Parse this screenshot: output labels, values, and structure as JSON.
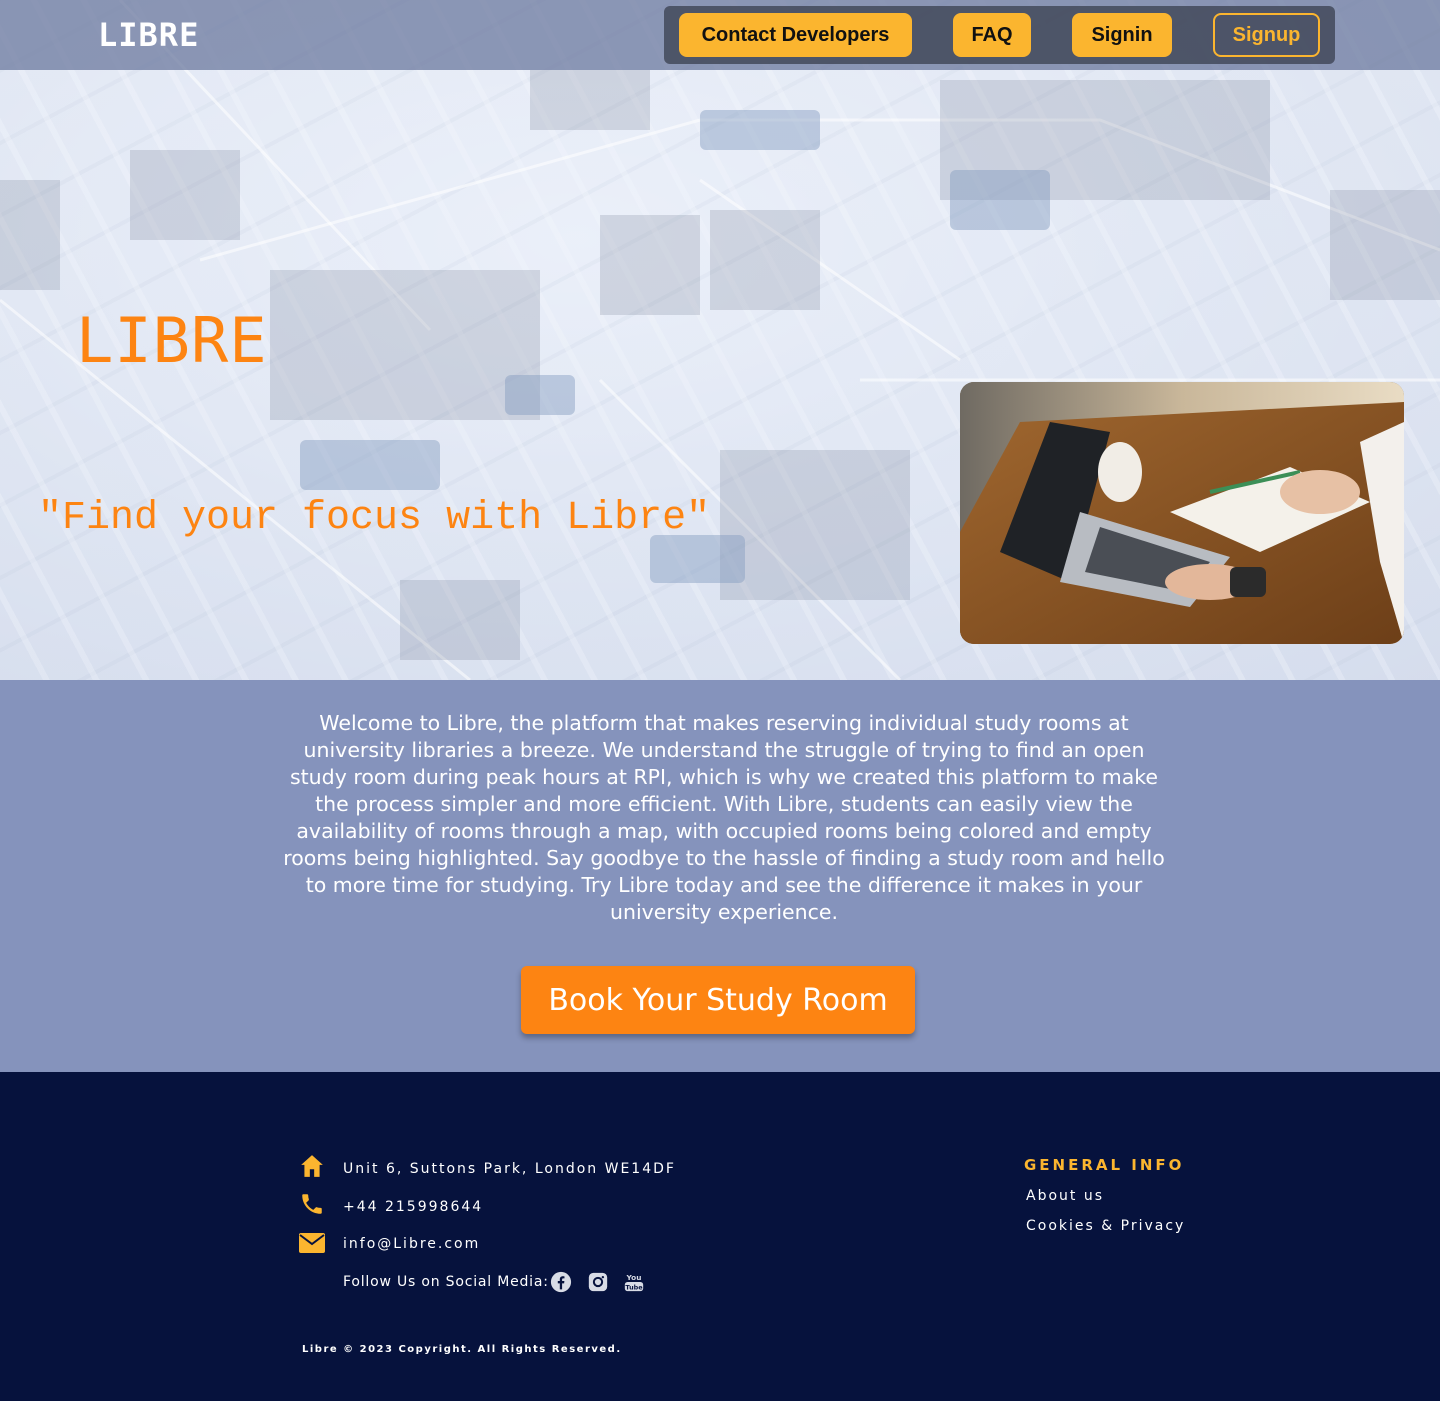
{
  "nav": {
    "brand": "LIBRE",
    "buttons": [
      {
        "label": "Contact Developers"
      },
      {
        "label": "FAQ"
      },
      {
        "label": "Signin"
      },
      {
        "label": "Signup"
      }
    ]
  },
  "hero": {
    "title": "LIBRE",
    "tagline": "\"Find your focus with Libre\""
  },
  "welcome": {
    "text": "Welcome to Libre, the platform that makes reserving individual study rooms at university libraries a breeze. We understand the struggle of trying to find an open study room during peak hours at RPI, which is why we created this platform to make the process simpler and more efficient. With Libre, students can easily view the availability of rooms through a map, with occupied rooms being colored and empty rooms being highlighted. Say goodbye to the hassle of finding a study room and hello to more time for studying. Try Libre today and see the difference it makes in your university experience.",
    "cta": "Book Your Study Room"
  },
  "footer": {
    "address": "Unit 6, Suttons Park, London WE14DF",
    "phone": "+44 215998644",
    "email": "info@Libre.com",
    "follow_label": "Follow Us on Social Media:",
    "social_icons": [
      "facebook-icon",
      "instagram-icon",
      "youtube-icon"
    ],
    "general_info_title": "GENERAL INFO",
    "links": [
      "About us",
      "Cookies & Privacy"
    ],
    "copyright": "Libre © 2023 Copyright. All Rights Reserved."
  },
  "colors": {
    "accent_yellow": "#fbb52f",
    "accent_orange": "#fd8412",
    "welcome_bg": "#8593bc",
    "footer_bg": "#06123d"
  }
}
